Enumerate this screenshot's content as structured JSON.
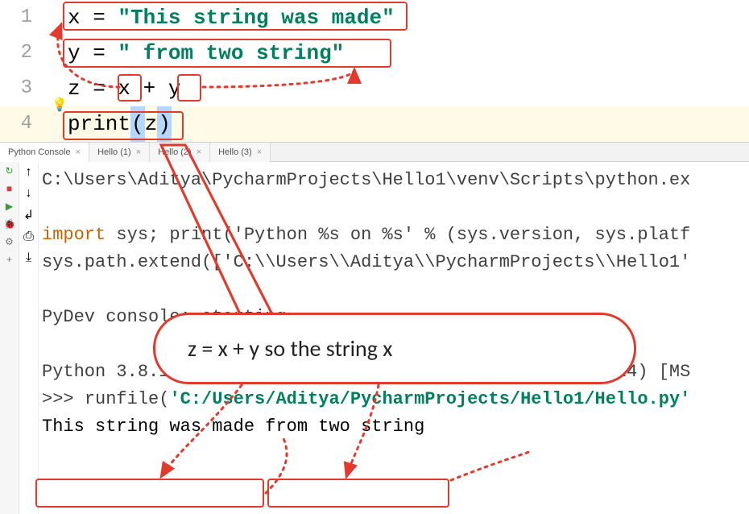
{
  "editor": {
    "lines": [
      {
        "num": "1",
        "var": "x",
        "op": " = ",
        "str": "\"This string was made\""
      },
      {
        "num": "2",
        "var": "y",
        "op": " = ",
        "str": "\" from two string\""
      },
      {
        "num": "3",
        "var": "z",
        "op": " = ",
        "rhs_a": "x",
        "rhs_plus": " + ",
        "rhs_b": "y"
      },
      {
        "num": "4",
        "fn": "print",
        "open": "(",
        "arg": "z",
        "close": ")"
      }
    ]
  },
  "tabs": [
    {
      "label": "Python Console",
      "active": true
    },
    {
      "label": "Hello (1)",
      "active": false
    },
    {
      "label": "Hello (2)",
      "active": false
    },
    {
      "label": "Hello (3)",
      "active": false
    }
  ],
  "console": {
    "path_line": "C:\\Users\\Aditya\\PycharmProjects\\Hello1\\venv\\Scripts\\python.ex",
    "import_prefix": "import",
    "import_rest": " sys; print('Python %s on %s' % (sys.version, sys.platf",
    "syspath": "sys.path.extend(['C:\\\\Users\\\\Aditya\\\\PycharmProjects\\\\Hello1'",
    "pydev": "PyDev console: starting.",
    "pyver": "Python 3.8.1 (tags/v3.8.1:1b293b6, Dec 18 2019, 22:39:24) [MS",
    "prompt": ">>> ",
    "runfile_fn": "runfile",
    "runfile_open": "(",
    "runfile_q1": "'",
    "runfile_path": "C:/Users/Aditya/PycharmProjects/Hello1/Hello.py",
    "runfile_q2": "'",
    "out_a": "This string was made",
    "out_b": " from two string"
  },
  "callout": {
    "text": "z = x + y so the string x"
  },
  "icons": {
    "rerun": "↻",
    "stop": "■",
    "play": "▶",
    "print": "⎙",
    "gear": "⚙",
    "plus": "+",
    "up": "↑",
    "down": "↓",
    "wrap": "↲",
    "scroll": "⤓"
  }
}
